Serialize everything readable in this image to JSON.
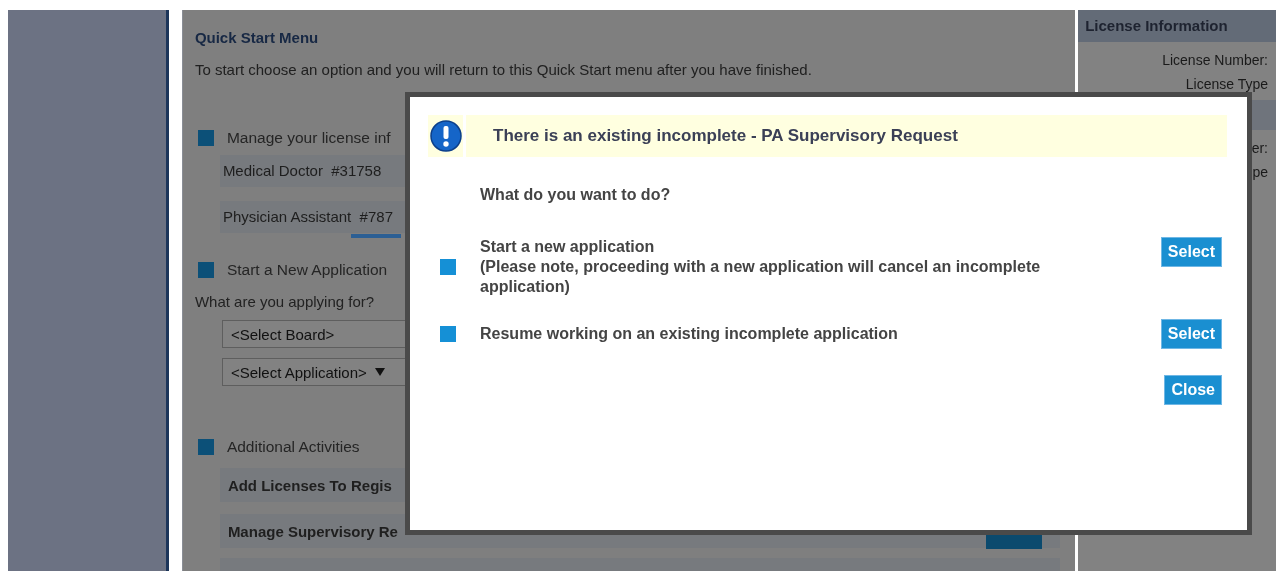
{
  "page": {
    "title": "Quick Start Menu",
    "intro": "To start choose an option and you will return to this Quick Start menu after you have finished.",
    "sections": [
      {
        "kind": "licenses",
        "heading": "Manage your license inf",
        "items": [
          "Medical Doctor  #31758",
          "Physician Assistant  #787"
        ]
      },
      {
        "kind": "application",
        "heading": "Start a New Application",
        "prompt": "What are you applying for?",
        "selects": [
          {
            "value": "<Select Board>",
            "caret": false
          },
          {
            "value": "<Select Application>",
            "caret": true
          }
        ]
      },
      {
        "kind": "activities",
        "heading": "Additional Activities",
        "items": [
          {
            "label": "Add Licenses To Regis"
          },
          {
            "label": "Manage Supervisory Re",
            "button": true
          }
        ]
      }
    ]
  },
  "license_panel": {
    "title": "License Information",
    "rows": [
      "License Number:",
      "License Type"
    ],
    "rows_2": [
      "er:",
      "pe"
    ]
  },
  "dialog": {
    "alert": "There is an existing incomplete - PA Supervisory Request",
    "question": "What do you want to do?",
    "options": [
      {
        "lines": [
          "Start a new application",
          "(Please note, proceeding with a new application will cancel an incomplete application)"
        ],
        "button": "Select"
      },
      {
        "lines": [
          "Resume working on an existing incomplete application"
        ],
        "button": "Select"
      }
    ],
    "close": "Close"
  }
}
